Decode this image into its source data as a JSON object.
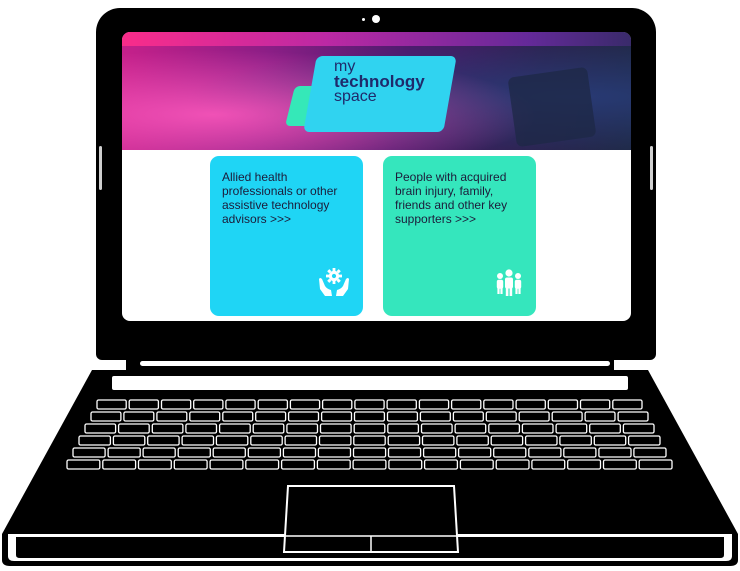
{
  "logo": {
    "line1": "my",
    "line2": "technology",
    "line3": "space"
  },
  "cards": [
    {
      "label": "Allied health professionals or other assistive technology advisors >>>",
      "icon": "hands-gear-icon",
      "color": "#1fd5f5"
    },
    {
      "label": "People with acquired brain injury, family, friends and other key supporters >>>",
      "icon": "people-group-icon",
      "color": "#35e6bd"
    }
  ]
}
